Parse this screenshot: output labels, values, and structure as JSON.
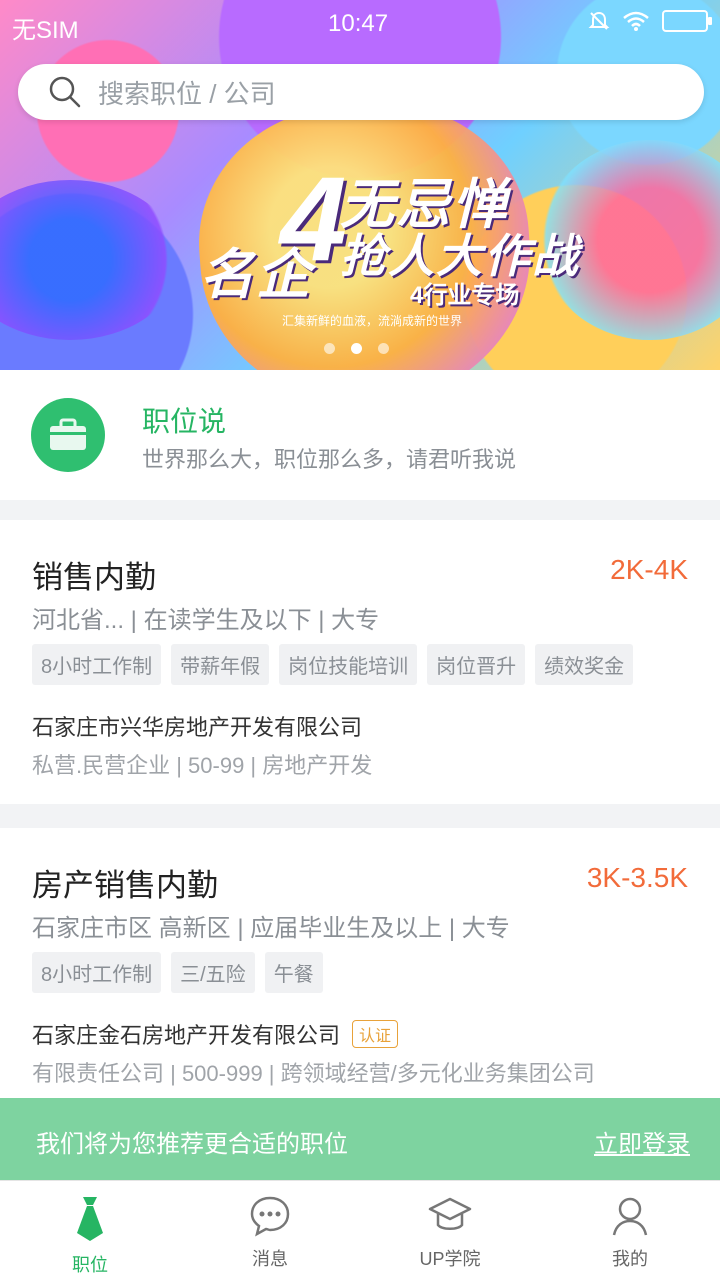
{
  "status_bar": {
    "carrier": "无SIM",
    "time": "10:47"
  },
  "search": {
    "placeholder": "搜索职位 / 公司"
  },
  "banner": {
    "headline_1": "无忌惮",
    "headline_2": "名企",
    "headline_3": "抢人大作战",
    "headline_4": "4行业专场",
    "tagline": "汇集新鲜的血液，流淌成新的世界",
    "big_char": "4",
    "dots_count": 3,
    "active_dot": 1
  },
  "feature": {
    "title": "职位说",
    "subtitle": "世界那么大，职位那么多，请君听我说"
  },
  "jobs": [
    {
      "title": "销售内勤",
      "salary": "2K-4K",
      "meta": "河北省... | 在读学生及以下 | 大专",
      "tags": [
        "8小时工作制",
        "带薪年假",
        "岗位技能培训",
        "岗位晋升",
        "绩效奖金"
      ],
      "company": "石家庄市兴华房地产开发有限公司",
      "verified": "",
      "company_info": "私营.民营企业 | 50-99 | 房地产开发"
    },
    {
      "title": "房产销售内勤",
      "salary": "3K-3.5K",
      "meta": "石家庄市区 高新区 | 应届毕业生及以上 | 大专",
      "tags": [
        "8小时工作制",
        "三/五险",
        "午餐"
      ],
      "company": "石家庄金石房地产开发有限公司",
      "verified": "认证",
      "company_info": "有限责任公司 | 500-999 | 跨领域经营/多元化业务集团公司"
    }
  ],
  "login_prompt": {
    "message": "我们将为您推荐更合适的职位",
    "action": "立即登录"
  },
  "nav": {
    "items": [
      {
        "label": "职位",
        "icon": "tie-icon",
        "active": true
      },
      {
        "label": "消息",
        "icon": "chat-bubble-icon",
        "active": false
      },
      {
        "label": "UP学院",
        "icon": "graduation-cap-icon",
        "active": false
      },
      {
        "label": "我的",
        "icon": "person-icon",
        "active": false
      }
    ]
  },
  "colors": {
    "brand_green": "#26b563",
    "salary_orange": "#f26b3a",
    "login_banner": "#7ed3a0"
  }
}
